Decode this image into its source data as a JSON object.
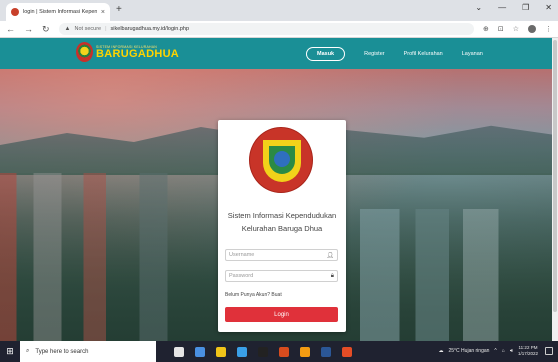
{
  "browser": {
    "tab_title": "login | Sistem Informasi Kependu...",
    "tab_close": "×",
    "new_tab": "+",
    "url_warning": "Not secure",
    "url": "sikelbarugadhua.my.id/login.php",
    "window_controls": [
      "⌄",
      "—",
      "❐",
      "✕"
    ]
  },
  "site": {
    "logo_small": "SISTEM INFORMASI KELURAHAN",
    "logo_big": "BARUGADHUA",
    "menu": [
      "Masuk",
      "Register",
      "Profil Kelurahan",
      "Layanan"
    ]
  },
  "login": {
    "title_line1": "Sistem Informasi Kependudukan",
    "title_line2": "Kelurahan Baruga Dhua",
    "username_placeholder": "Username",
    "password_placeholder": "Password",
    "register_prompt": "Belum Punya Akun? Buat",
    "login_button": "Login"
  },
  "taskbar": {
    "search_placeholder": "Type here to search",
    "weather": "25°C  Hujan ringan",
    "time": "11:22 PM",
    "date": "1/17/2022",
    "app_colors": [
      "#e5e5e5",
      "#4a90e2",
      "#f0c419",
      "#3aa0e8",
      "#222222",
      "#d84c1e",
      "#f39c12",
      "#2b5797",
      "#e44d26"
    ]
  }
}
